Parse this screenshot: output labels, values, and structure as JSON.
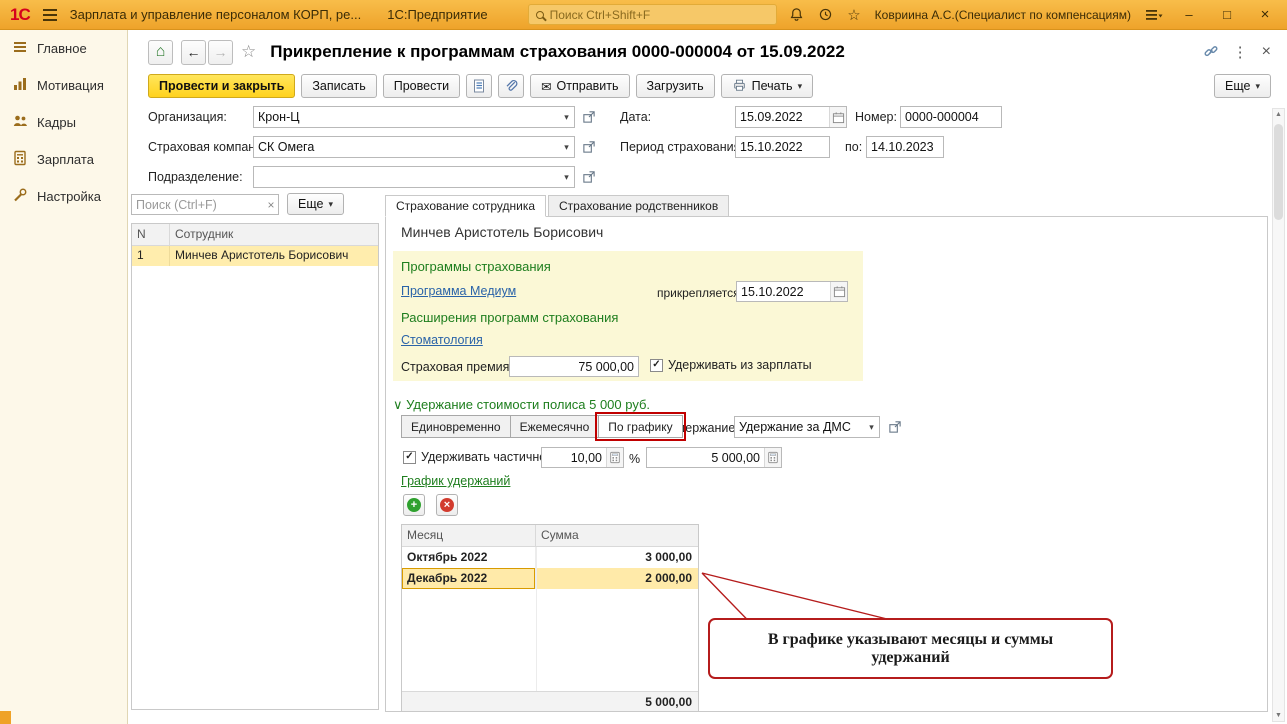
{
  "icons": {
    "dropdown": "▾",
    "star_outline": "☆",
    "back_arrow": "←",
    "forward_arrow": "→",
    "home": "⌂",
    "vertical_dots": "⋮",
    "close": "×",
    "minimize": "–",
    "maximize": "□",
    "envelope": "✉",
    "check": "✓",
    "plus": "+",
    "chevron_down": "∨",
    "scroll_up": "▲",
    "scroll_down": "▼"
  },
  "titlebar": {
    "logo": "1С",
    "app_title": "Зарплата и управление персоналом КОРП, ре...",
    "platform": "1С:Предприятие",
    "search_placeholder": "Поиск Ctrl+Shift+F",
    "user": "Ковриина А.С.(Специалист по компенсациям)"
  },
  "sidebar": {
    "items": [
      {
        "label": "Главное"
      },
      {
        "label": "Мотивация"
      },
      {
        "label": "Кадры"
      },
      {
        "label": "Зарплата"
      },
      {
        "label": "Настройка"
      }
    ]
  },
  "doc": {
    "title": "Прикрепление к программам страхования 0000-000004 от 15.09.2022",
    "toolbar": {
      "post_close": "Провести и закрыть",
      "save": "Записать",
      "post": "Провести",
      "send": "Отправить",
      "load": "Загрузить",
      "print": "Печать",
      "more": "Еще"
    },
    "header_fields": {
      "org_label": "Организация:",
      "org_value": "Крон-Ц",
      "date_label": "Дата:",
      "date_value": "15.09.2022",
      "number_label": "Номер:",
      "number_value": "0000-000004",
      "insurer_label": "Страховая компания:",
      "insurer_value": "СК Омега",
      "period_label": "Период страхования с:",
      "period_from": "15.10.2022",
      "period_to_label": "по:",
      "period_to": "14.10.2023",
      "dept_label": "Подразделение:"
    },
    "employees": {
      "search_placeholder": "Поиск (Ctrl+F)",
      "more": "Еще",
      "col_n": "N",
      "col_name": "Сотрудник",
      "rows": [
        {
          "n": "1",
          "name": "Минчев Аристотель Борисович"
        }
      ]
    },
    "tabs": [
      {
        "label": "Страхование сотрудника"
      },
      {
        "label": "Страхование родственников"
      }
    ],
    "employee_name": "Минчев Аристотель Борисович",
    "insurance": {
      "programs_header": "Программы страхования",
      "program_link": "Программа Медиум",
      "attach_label": "прикрепляется с:",
      "attach_date": "15.10.2022",
      "extensions_header": "Расширения программ страхования",
      "extension_link": "Стоматология",
      "premium_label": "Страховая премия:",
      "premium_value": "75 000,00",
      "withhold_salary_label": "Удерживать из зарплаты"
    },
    "withholding": {
      "section_title": "Удержание стоимости полиса 5 000 руб.",
      "mode_once": "Единовременно",
      "mode_monthly": "Ежемесячно",
      "mode_schedule": "По графику",
      "deduction_label": "Удержание:",
      "deduction_value": "Удержание за ДМС",
      "partial_label": "Удерживать частично",
      "percent_value": "10,00",
      "percent_sign": "%",
      "amount_value": "5 000,00",
      "schedule_link": "График удержаний",
      "table": {
        "col_month": "Месяц",
        "col_sum": "Сумма",
        "rows": [
          {
            "month": "Октябрь 2022",
            "sum": "3 000,00"
          },
          {
            "month": "Декабрь 2022",
            "sum": "2 000,00"
          }
        ],
        "total": "5 000,00"
      }
    },
    "annotation": "В графике указывают месяцы и суммы удержаний"
  }
}
